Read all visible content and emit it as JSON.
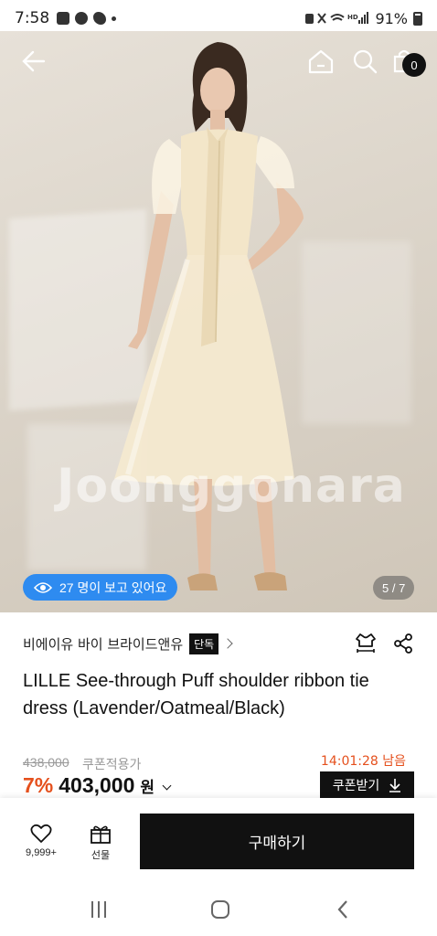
{
  "status_bar": {
    "time": "7:58",
    "battery": "91%"
  },
  "hero": {
    "watermark": "Joonggonara",
    "viewers_text": "27 명이 보고 있어요",
    "pager": "5 / 7",
    "cart_count": "0"
  },
  "product": {
    "brand": "비에이유 바이 브라이드앤유",
    "exclusive_badge": "단독",
    "title": "LILLE See-through Puff shoulder ribbon tie dress (Lavender/Oatmeal/Black)",
    "original_price": "438,000",
    "coupon_label": "쿠폰적용가",
    "timer": "14:01:28 남음",
    "discount": "7%",
    "price": "403,000",
    "currency": "원",
    "coupon_button": "쿠폰받기"
  },
  "bottom_bar": {
    "like_count": "9,999+",
    "gift_label": "선물",
    "buy_label": "구매하기"
  },
  "colors": {
    "accent_blue": "#2e8bf0",
    "discount_orange": "#e5501d",
    "dark": "#111111"
  }
}
